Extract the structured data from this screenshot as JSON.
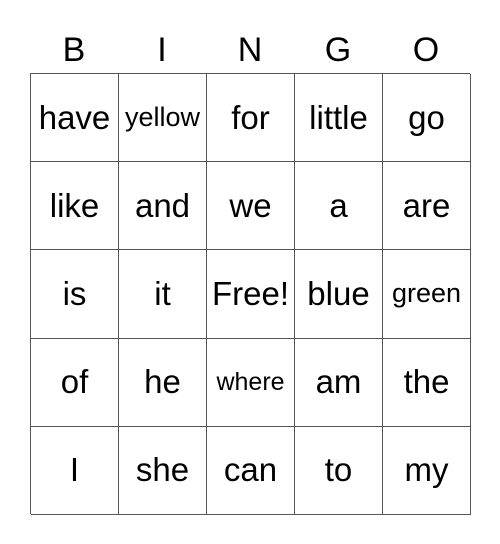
{
  "header": [
    "B",
    "I",
    "N",
    "G",
    "O"
  ],
  "grid": [
    [
      "have",
      "yellow",
      "for",
      "little",
      "go"
    ],
    [
      "like",
      "and",
      "we",
      "a",
      "are"
    ],
    [
      "is",
      "it",
      "Free!",
      "blue",
      "green"
    ],
    [
      "of",
      "he",
      "where",
      "am",
      "the"
    ],
    [
      "I",
      "she",
      "can",
      "to",
      "my"
    ]
  ],
  "free_space_label": "Free!"
}
